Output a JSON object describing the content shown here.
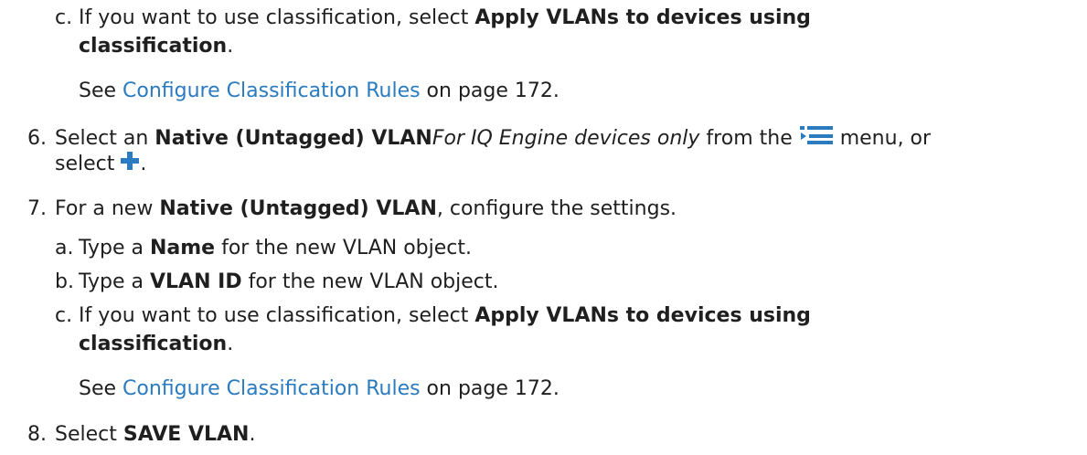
{
  "icons": {
    "menu": "list-menu-icon",
    "add": "add-plus-icon",
    "color": "#2a7bbf"
  },
  "steps": {
    "s5": {
      "c": {
        "marker": "c.",
        "pre": "If you want to use classification, select ",
        "bold": "Apply VLANs to devices using",
        "bold2": "classification",
        "post": "."
      },
      "see": {
        "pre": "See ",
        "link": "Configure Classification Rules",
        "post": " on page 172."
      }
    },
    "s6": {
      "marker": "6.",
      "pre": "Select an ",
      "bold": "Native (Untagged) VLAN",
      "italic": "For IQ Engine devices only",
      "mid": " from the ",
      "post": " menu, or",
      "select": "select",
      "end": "."
    },
    "s7": {
      "marker": "7.",
      "pre": "For a new ",
      "bold": "Native (Untagged) VLAN",
      "post": ", configure the settings.",
      "a": {
        "marker": "a.",
        "pre": "Type a ",
        "bold": "Name",
        "post": " for the new VLAN object."
      },
      "b": {
        "marker": "b.",
        "pre": "Type a ",
        "bold": "VLAN ID",
        "post": " for the new VLAN object."
      },
      "c": {
        "marker": "c.",
        "pre": "If you want to use classification, select ",
        "bold": "Apply VLANs to devices using",
        "bold2": "classification",
        "post": "."
      },
      "see": {
        "pre": "See ",
        "link": "Configure Classification Rules",
        "post": " on page 172."
      }
    },
    "s8": {
      "marker": "8.",
      "pre": "Select ",
      "bold": "SAVE VLAN",
      "post": "."
    }
  }
}
